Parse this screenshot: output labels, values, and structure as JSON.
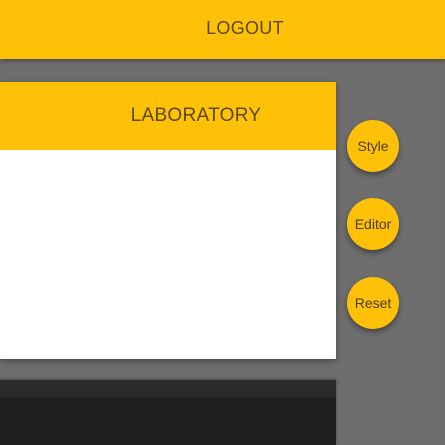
{
  "top_bar": {
    "logout_label": "LOGOUT"
  },
  "panel": {
    "title": "LABORATORY"
  },
  "fabs": {
    "style_label": "Style",
    "editor_label": "Editor",
    "reset_label": "Reset"
  },
  "colors": {
    "accent": "#ffc107",
    "background": "#6e6e6e",
    "panel_body": "#ffffff",
    "dark_area": "#1f1f1f"
  }
}
